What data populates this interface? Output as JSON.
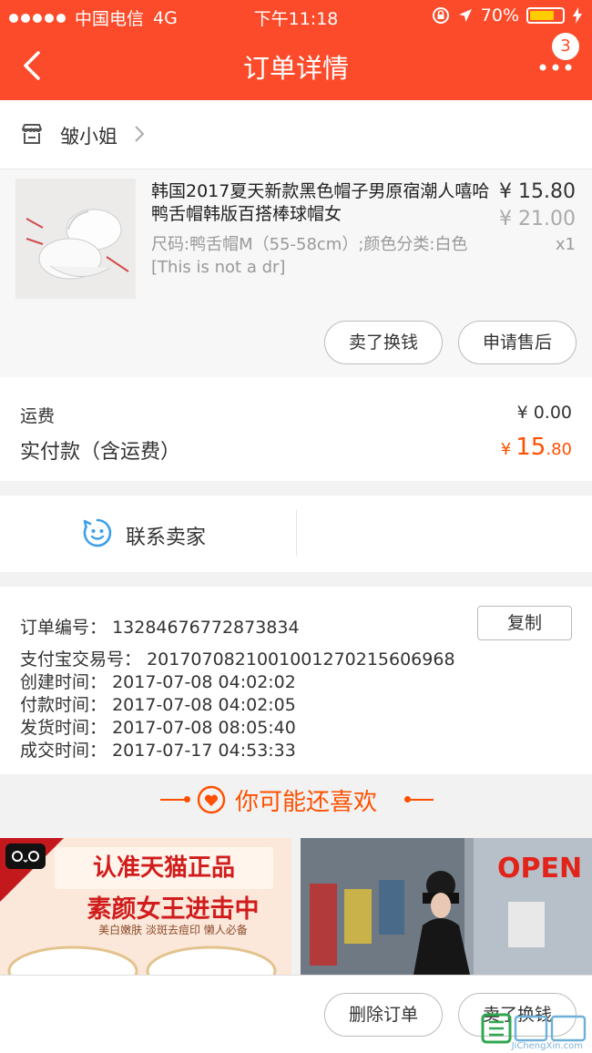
{
  "status_bar": {
    "carrier": "中国电信",
    "network": "4G",
    "time": "下午11:18",
    "battery": "70%"
  },
  "nav": {
    "title": "订单详情",
    "badge_count": "3"
  },
  "shop": {
    "name": "皱小姐"
  },
  "product": {
    "title": "韩国2017夏天新款黑色帽子男原宿潮人嘻哈鸭舌帽韩版百搭棒球帽女",
    "spec": "尺码:鸭舌帽M（55-58cm）;颜色分类:白色[This is not a dr]",
    "price": "¥ 15.80",
    "original_price": "¥ 21.00",
    "quantity": "x1",
    "sell_button": "卖了换钱",
    "after_sale_button": "申请售后"
  },
  "totals": {
    "shipping_label": "运费",
    "shipping_value": "¥ 0.00",
    "paid_label": "实付款（含运费）",
    "paid_symbol": "¥",
    "paid_int": "15",
    "paid_dec": ".80"
  },
  "contact": {
    "label": "联系卖家"
  },
  "order_info": {
    "order_no_label": "订单编号：",
    "order_no": "13284676772873834",
    "copy_button": "复制",
    "alipay_label": "支付宝交易号：",
    "alipay_no": "20170708210010012702156069​68",
    "created_label": "创建时间：",
    "created": "2017-07-08 04:02:02",
    "paid_label": "付款时间：",
    "paid": "2017-07-08 04:02:05",
    "shipped_label": "发货时间：",
    "shipped": "2017-07-08 08:05:40",
    "done_label": "成交时间：",
    "done": "2017-07-17 04:53:33"
  },
  "recommend": {
    "title": "你可能还喜欢",
    "card1_head": "认准天猫正品",
    "card1_sub": "素颜女王进击中",
    "card1_tag": "美白嫩肤 淡斑去痘印 懒人必备",
    "card2_sign": "OPEN"
  },
  "bottom_bar": {
    "delete_button": "删除订单",
    "sell_button": "卖了换钱"
  },
  "watermark": {
    "text": "JiChengXin.com"
  },
  "colors": {
    "brand": "#fb4b2a",
    "price_accent": "#ff5000",
    "contact_icon": "#3aa0e8"
  }
}
